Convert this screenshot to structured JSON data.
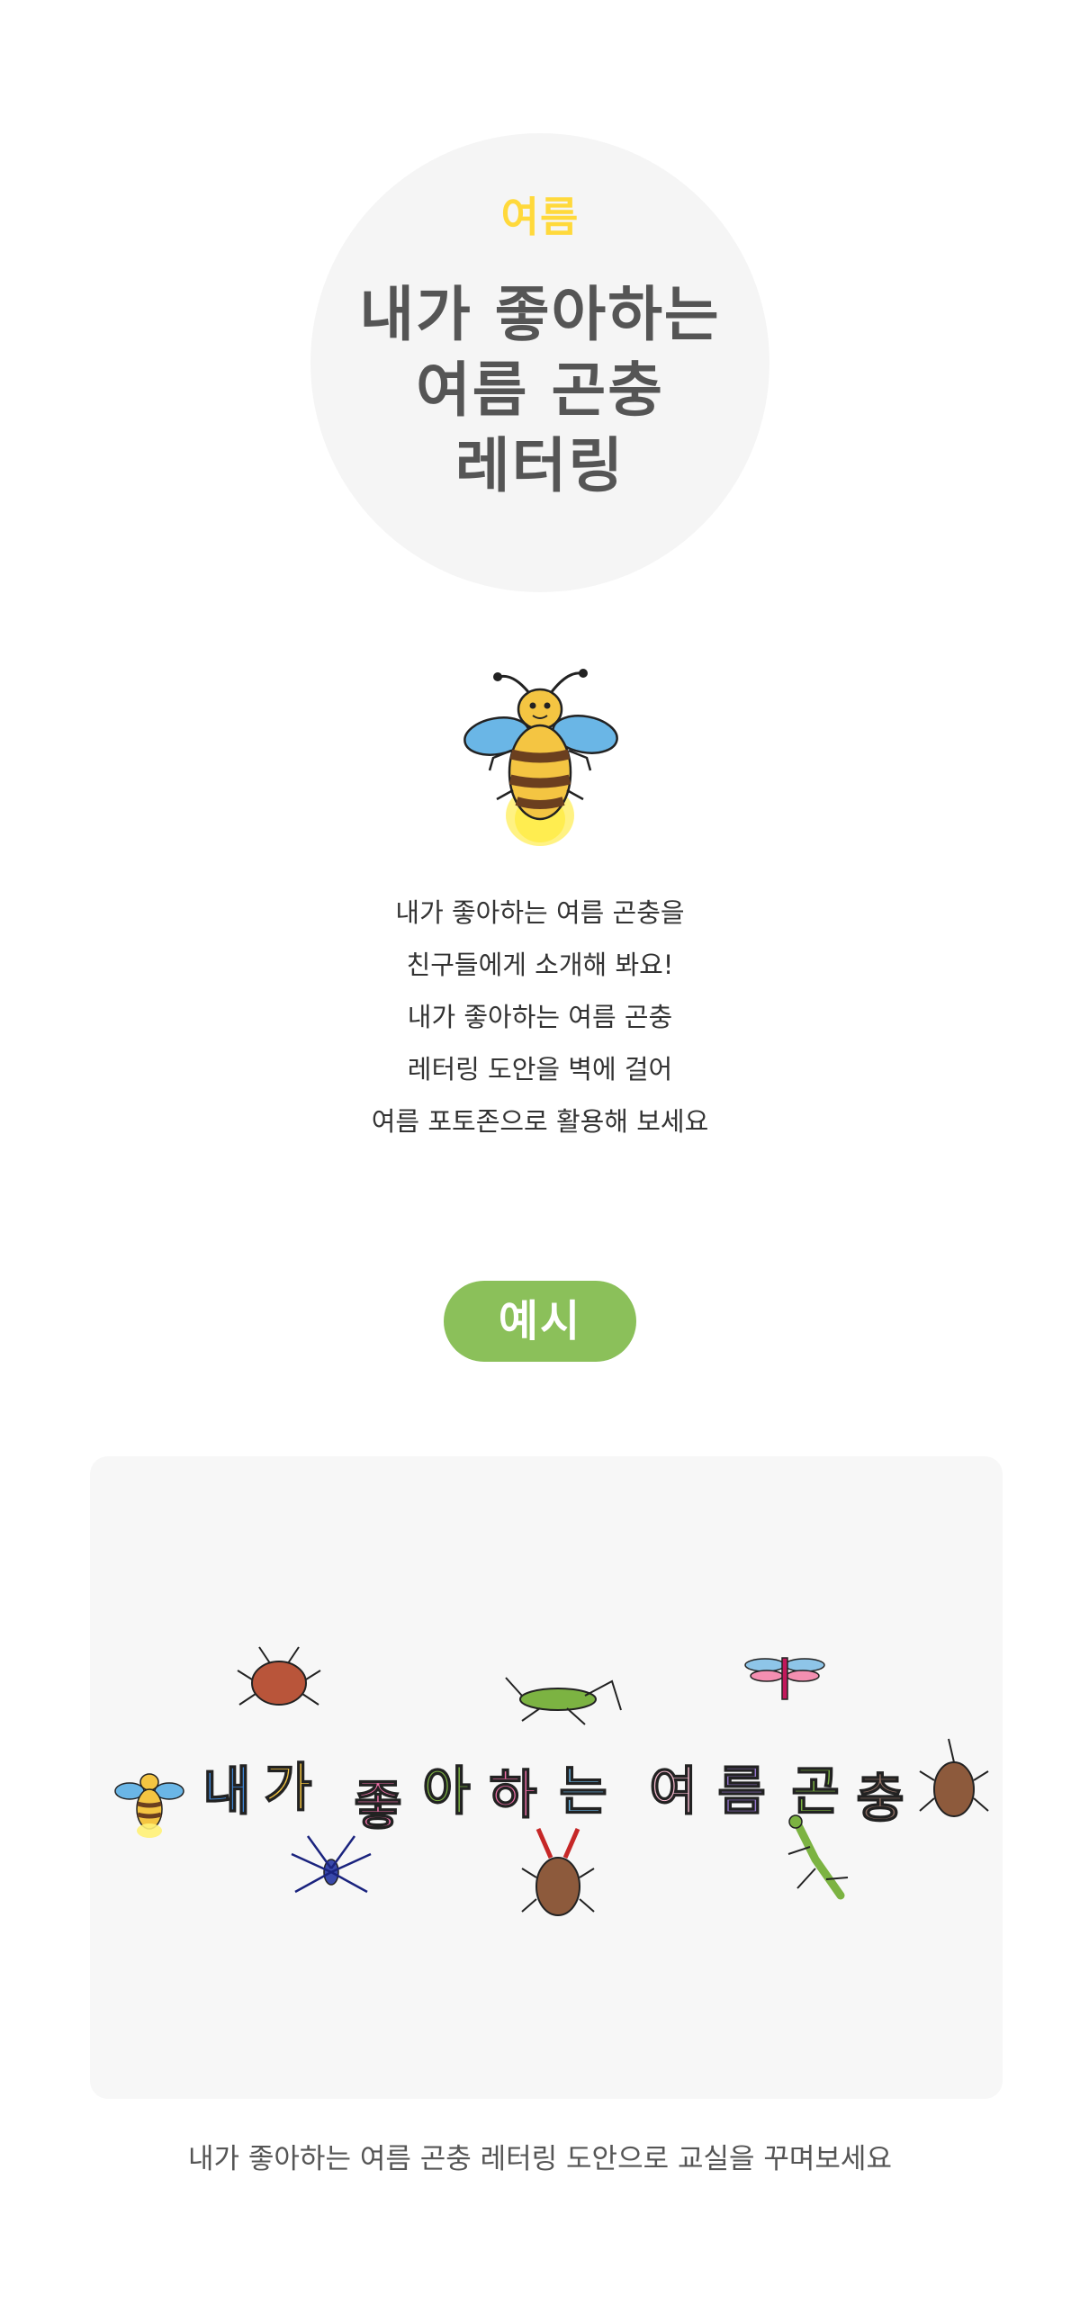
{
  "hero": {
    "season": "여름",
    "title_lines": [
      "내가 좋아하는",
      "여름 곤충",
      "레터링"
    ]
  },
  "description": {
    "lines": [
      "내가 좋아하는 여름 곤충을",
      "친구들에게 소개해 봐요!",
      "내가 좋아하는 여름 곤충",
      "레터링 도안을 벽에 걸어",
      "여름 포토존으로 활용해 보세요"
    ]
  },
  "example": {
    "badge_label": "예시",
    "lettering_chars": [
      "내",
      "가",
      "좋",
      "아",
      "하",
      "는",
      "여",
      "름",
      "곤",
      "충"
    ],
    "caption": "내가 좋아하는 여름 곤충 레터링 도안으로 교실을 꾸며보세요"
  },
  "colors": {
    "season": "#ffd93b",
    "title": "#555555",
    "badge": "#8bc05a",
    "panel": "#f7f7f7",
    "circle": "#f5f5f5"
  },
  "icons": [
    "firefly-bee-illustration",
    "beetle-icon",
    "grasshopper-icon",
    "dragonfly-icon",
    "stag-beetle-icon",
    "mantis-icon",
    "water-strider-icon",
    "rhinoceros-beetle-icon"
  ]
}
